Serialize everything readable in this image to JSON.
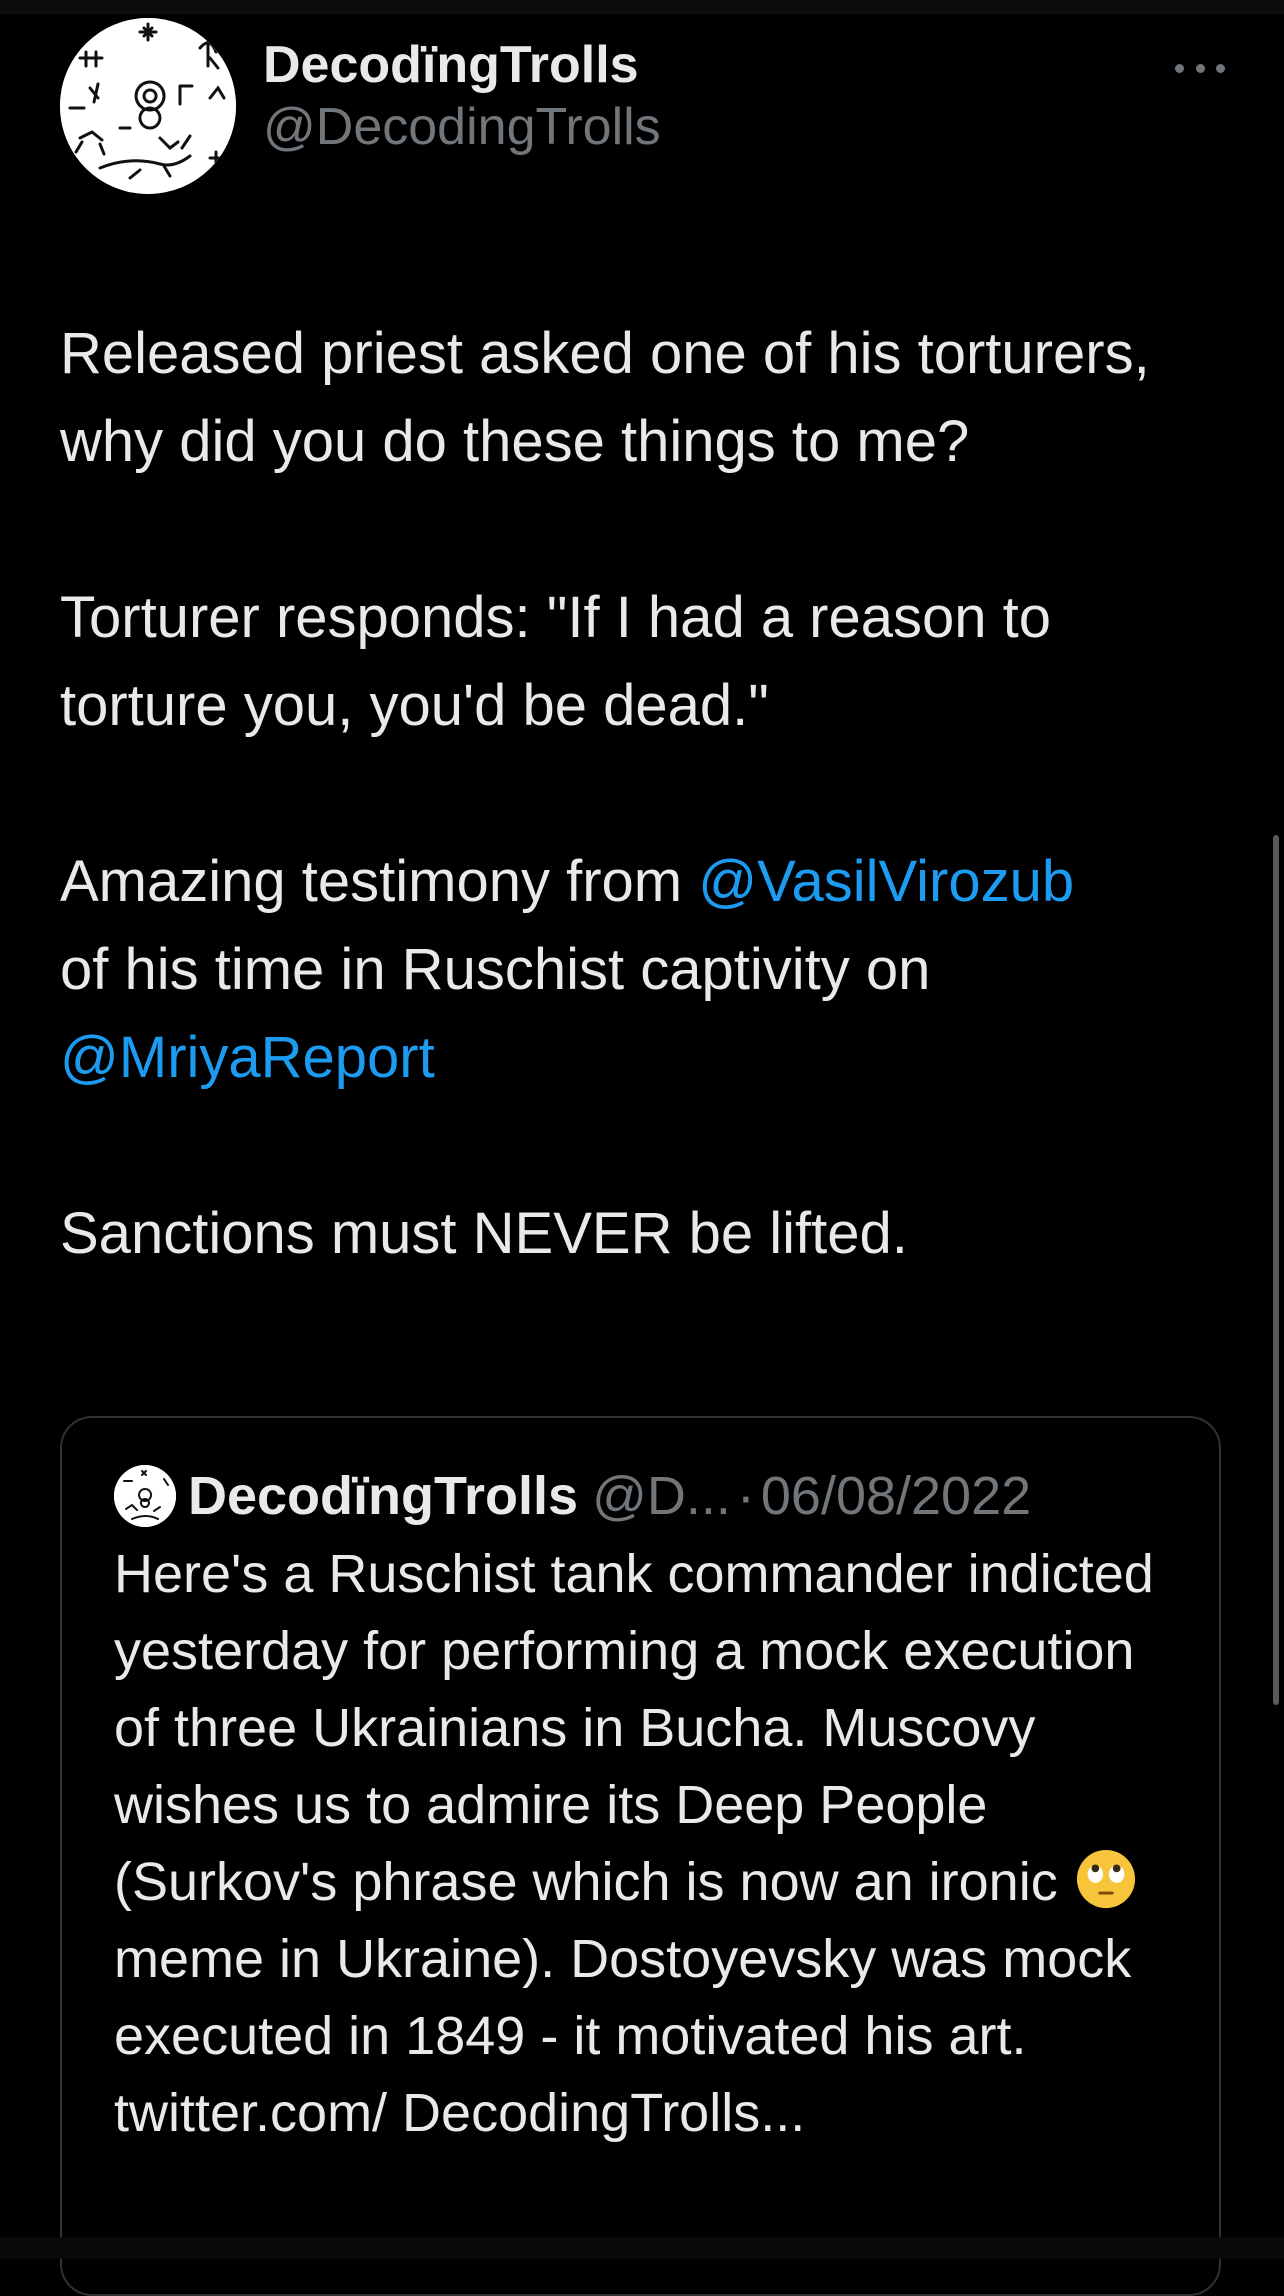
{
  "tweet": {
    "author": {
      "display_name": "DecodïngTrolls",
      "handle": "@DecodingTrolls",
      "avatar_icon": "petroglyph-avatar-icon"
    },
    "more_icon": "more-options-icon",
    "body": {
      "p1": "Released priest asked one of his torturers, why did you do these things to me?",
      "p2": "Torturer responds: \"If I had a reason to torture you, you'd be dead.\"",
      "p3_before": "Amazing testimony from ",
      "p3_mention1": "@VasilVirozub",
      "p3_middle": " of his time in Ruschist captivity on ",
      "p3_mention2": "@MriyaReport",
      "p4": "Sanctions must NEVER be lifted."
    },
    "quote": {
      "display_name": "DecodïngTrolls",
      "handle": "@D...",
      "separator": "·",
      "date": "06/08/2022",
      "text_before_emoji": "Here's a Ruschist tank commander indicted yesterday for performing a mock execution of three Ukrainians in Bucha. Muscovy wishes us to admire its Deep People (Surkov's phrase which is now an ironic ",
      "emoji": "eye-roll-emoji",
      "text_after_emoji": "meme in Ukraine). Dostoyevsky was mock executed in 1849 - it motivated his art. twitter.com/ DecodingTrolls..."
    }
  },
  "colors": {
    "background": "#000000",
    "text": "#e7e9ea",
    "secondary": "#71767b",
    "link": "#1d9bf0",
    "border": "#2f3336"
  }
}
